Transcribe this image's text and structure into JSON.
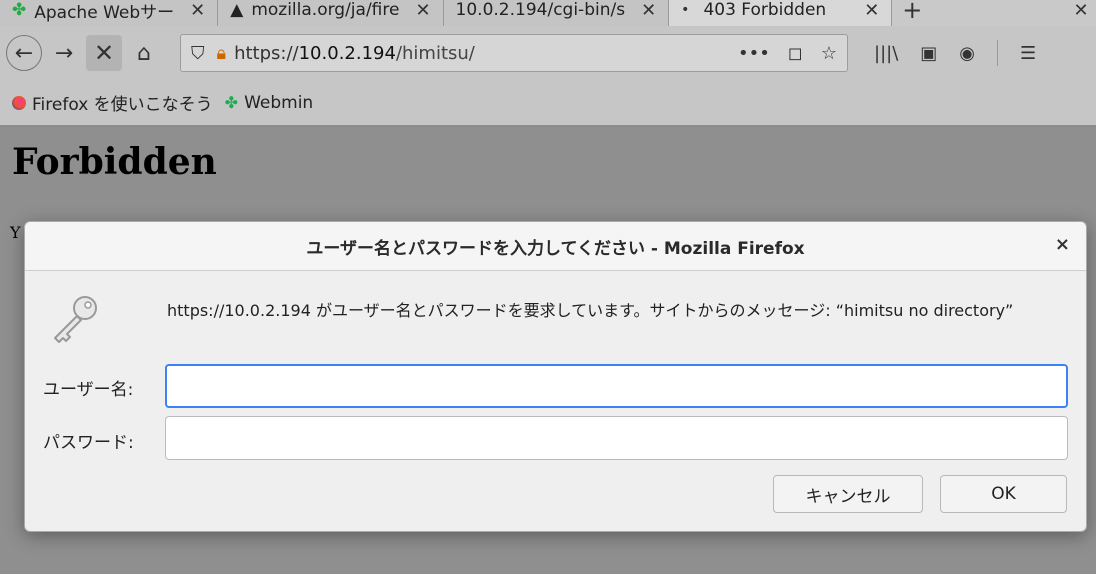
{
  "tabs": [
    {
      "label": "Apache Webサー",
      "icon": "apache-icon",
      "close": "✕"
    },
    {
      "label": "mozilla.org/ja/fire",
      "icon": "warning-icon",
      "close": "✕"
    },
    {
      "label": "10.0.2.194/cgi-bin/s",
      "close": "✕"
    },
    {
      "label": "403 Forbidden",
      "close": "✕",
      "dot": "•"
    }
  ],
  "new_tab": "+",
  "overflow": "✕",
  "nav": {
    "back": "←",
    "forward": "→",
    "stop": "✕",
    "home": "⌂"
  },
  "url": {
    "scheme": "https://",
    "host": "10.0.2.194",
    "path": "/himitsu/",
    "menu": "•••",
    "pocket": "◻",
    "star": "☆"
  },
  "toolbar": {
    "library": "|||\\",
    "sidebar": "▣",
    "account": "◉",
    "menu": "☰"
  },
  "bookmarks": [
    {
      "label": "Firefox を使いこなそう",
      "icon": "firefox-icon"
    },
    {
      "label": "Webmin",
      "icon": "webmin-icon"
    }
  ],
  "page": {
    "heading": "Forbidden",
    "para_start": "Y"
  },
  "dialog": {
    "title": "ユーザー名とパスワードを入力してください - Mozilla Firefox",
    "close": "×",
    "message": "https://10.0.2.194 がユーザー名とパスワードを要求しています。サイトからのメッセージ: “himitsu no directory”",
    "username_label": "ユーザー名:",
    "password_label": "パスワード:",
    "username_value": "",
    "password_value": "",
    "cancel_label": "キャンセル",
    "ok_label": "OK"
  }
}
